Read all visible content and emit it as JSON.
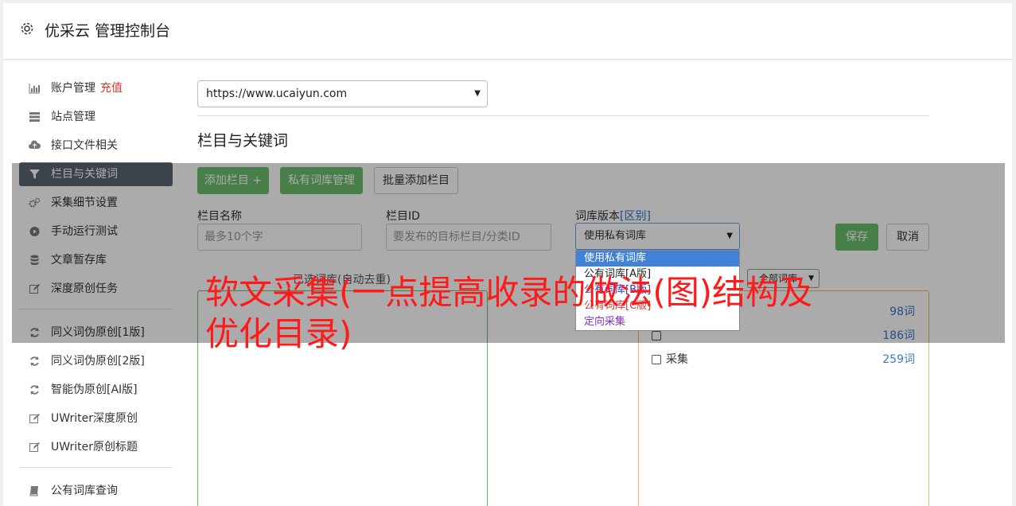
{
  "header": {
    "title": "优采云 管理控制台",
    "icon": "gear-icon"
  },
  "sidebar": {
    "group1": [
      {
        "label": "账户管理",
        "extra": "充值",
        "icon": "bar-chart-icon"
      },
      {
        "label": "站点管理",
        "icon": "server-icon"
      },
      {
        "label": "接口文件相关",
        "icon": "cloud-upload-icon"
      },
      {
        "label": "栏目与关键词",
        "icon": "filter-icon",
        "active": true
      },
      {
        "label": "采集细节设置",
        "icon": "cogs-icon"
      },
      {
        "label": "手动运行测试",
        "icon": "play-icon"
      },
      {
        "label": "文章暂存库",
        "icon": "database-icon"
      },
      {
        "label": "深度原创任务",
        "icon": "edit-icon"
      }
    ],
    "group2": [
      {
        "label": "同义词伪原创[1版]",
        "icon": "refresh-icon"
      },
      {
        "label": "同义词伪原创[2版]",
        "icon": "refresh-icon"
      },
      {
        "label": "智能伪原创[AI版]",
        "icon": "refresh-icon"
      },
      {
        "label": "UWriter深度原创",
        "icon": "edit-icon"
      },
      {
        "label": "UWriter原创标题",
        "icon": "edit-icon"
      }
    ],
    "group3": [
      {
        "label": "公有词库查询",
        "icon": "book-icon"
      }
    ]
  },
  "main": {
    "site_select": "https://www.ucaiyun.com",
    "section_title": "栏目与关键词",
    "buttons": {
      "add_column": "添加栏目 +",
      "private_lib": "私有词库管理",
      "batch_add": "批量添加栏目",
      "save": "保存",
      "cancel": "取消"
    },
    "fields": {
      "column_name_label": "栏目名称",
      "column_name_placeholder": "最多10个字",
      "column_id_label": "栏目ID",
      "column_id_placeholder": "要发布的目标栏目/分类ID",
      "lib_version_label": "词库版本",
      "lib_version_link": "[区别]",
      "lib_version_value": "使用私有词库"
    },
    "lib_options": [
      "使用私有词库",
      "公有词库[A版]",
      "公有词库[B版]",
      "公有词库[C版]",
      "定向采集"
    ],
    "selected_label": "已选词库(自动去重)",
    "all_lib_select": "全部词库",
    "keywords": [
      {
        "name": "",
        "count": "98词"
      },
      {
        "name": "",
        "count": "186词"
      },
      {
        "name": "采集",
        "count": "259词"
      }
    ]
  },
  "headline": "软文采集(一点提高收录的做法(图)结构及优化目录)"
}
